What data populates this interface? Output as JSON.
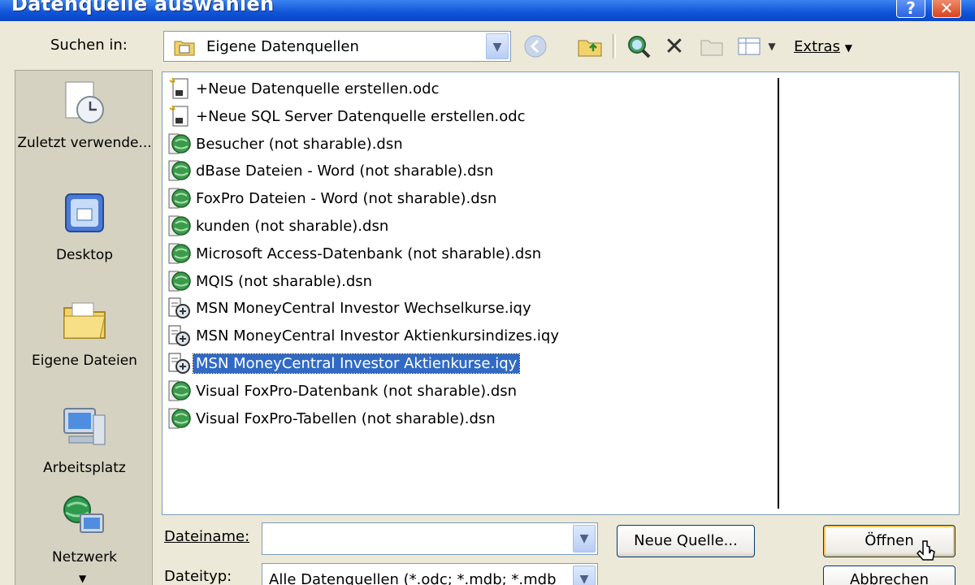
{
  "window": {
    "title": "Datenquelle auswählen",
    "help_glyph": "?",
    "close_glyph": "✕"
  },
  "toolbar": {
    "look_in_label": "Suchen in:",
    "look_in_value": "Eigene Datenquellen",
    "extras_label": "Extras"
  },
  "places": [
    {
      "label": "Zuletzt verwende...",
      "icon": "recent-documents-icon"
    },
    {
      "label": "Desktop",
      "icon": "desktop-icon"
    },
    {
      "label": "Eigene Dateien",
      "icon": "my-documents-icon"
    },
    {
      "label": "Arbeitsplatz",
      "icon": "my-computer-icon"
    },
    {
      "label": "Netzwerk",
      "icon": "network-icon"
    }
  ],
  "files": [
    {
      "name": "+Neue Datenquelle erstellen.odc",
      "icon": "odc-file-icon"
    },
    {
      "name": "+Neue SQL Server Datenquelle erstellen.odc",
      "icon": "odc-file-icon"
    },
    {
      "name": "Besucher (not sharable).dsn",
      "icon": "dsn-file-icon"
    },
    {
      "name": "dBase Dateien - Word (not sharable).dsn",
      "icon": "dsn-file-icon"
    },
    {
      "name": "FoxPro Dateien - Word (not sharable).dsn",
      "icon": "dsn-file-icon"
    },
    {
      "name": "kunden (not sharable).dsn",
      "icon": "dsn-file-icon"
    },
    {
      "name": "Microsoft Access-Datenbank (not sharable).dsn",
      "icon": "dsn-file-icon"
    },
    {
      "name": "MQIS (not sharable).dsn",
      "icon": "dsn-file-icon"
    },
    {
      "name": "MSN MoneyCentral Investor Wechselkurse.iqy",
      "icon": "iqy-file-icon"
    },
    {
      "name": "MSN MoneyCentral Investor Aktienkursindizes.iqy",
      "icon": "iqy-file-icon"
    },
    {
      "name": "MSN MoneyCentral Investor Aktienkurse.iqy",
      "icon": "iqy-file-icon",
      "selected": true
    },
    {
      "name": "Visual FoxPro-Datenbank (not sharable).dsn",
      "icon": "dsn-file-icon"
    },
    {
      "name": "Visual FoxPro-Tabellen (not sharable).dsn",
      "icon": "dsn-file-icon"
    }
  ],
  "footer": {
    "filename_label": "Dateiname:",
    "filename_value": "",
    "filetype_label": "Dateityp:",
    "filetype_value": "Alle Datenquellen (*.odc; *.mdb; *.mdb",
    "new_source_button": "Neue Quelle...",
    "open_button": "Öffnen",
    "cancel_button": "Abbrechen"
  },
  "colors": {
    "titlebar": "#0f53d8",
    "selection": "#316ac5",
    "dialog_bg": "#ece9d8"
  }
}
